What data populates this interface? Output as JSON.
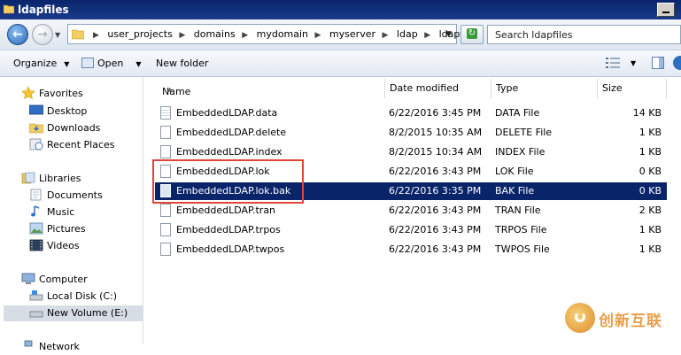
{
  "window": {
    "title": "ldapfiles"
  },
  "address": {
    "crumbs": [
      "user_projects",
      "domains",
      "mydomain",
      "myserver",
      "ldap",
      "ldapfiles"
    ],
    "search_placeholder": "Search ldapfiles"
  },
  "toolbar": {
    "organize": "Organize",
    "open": "Open",
    "new_folder": "New folder"
  },
  "nav": {
    "favorites": "Favorites",
    "desktop": "Desktop",
    "downloads": "Downloads",
    "recent_places": "Recent Places",
    "libraries": "Libraries",
    "documents": "Documents",
    "music": "Music",
    "pictures": "Pictures",
    "videos": "Videos",
    "computer": "Computer",
    "local_disk": "Local Disk (C:)",
    "new_volume": "New Volume (E:)",
    "network": "Network"
  },
  "columns": {
    "name": "Name",
    "date": "Date modified",
    "type": "Type",
    "size": "Size"
  },
  "files": [
    {
      "name": "EmbeddedLDAP.data",
      "date": "6/22/2016 3:45 PM",
      "type": "DATA File",
      "size": "14 KB"
    },
    {
      "name": "EmbeddedLDAP.delete",
      "date": "8/2/2015 10:35 AM",
      "type": "DELETE File",
      "size": "1 KB"
    },
    {
      "name": "EmbeddedLDAP.index",
      "date": "8/2/2015 10:34 AM",
      "type": "INDEX File",
      "size": "1 KB"
    },
    {
      "name": "EmbeddedLDAP.lok",
      "date": "6/22/2016 3:43 PM",
      "type": "LOK File",
      "size": "0 KB"
    },
    {
      "name": "EmbeddedLDAP.lok.bak",
      "date": "6/22/2016 3:35 PM",
      "type": "BAK File",
      "size": "0 KB"
    },
    {
      "name": "EmbeddedLDAP.tran",
      "date": "6/22/2016 3:43 PM",
      "type": "TRAN File",
      "size": "2 KB"
    },
    {
      "name": "EmbeddedLDAP.trpos",
      "date": "6/22/2016 3:43 PM",
      "type": "TRPOS File",
      "size": "1 KB"
    },
    {
      "name": "EmbeddedLDAP.twpos",
      "date": "6/22/2016 3:43 PM",
      "type": "TWPOS File",
      "size": "1 KB"
    }
  ],
  "watermark": {
    "text": "创新互联"
  },
  "colors": {
    "selection": "#0a246a",
    "highlight_box": "#e0453a",
    "titlebar": "#0a246a"
  }
}
